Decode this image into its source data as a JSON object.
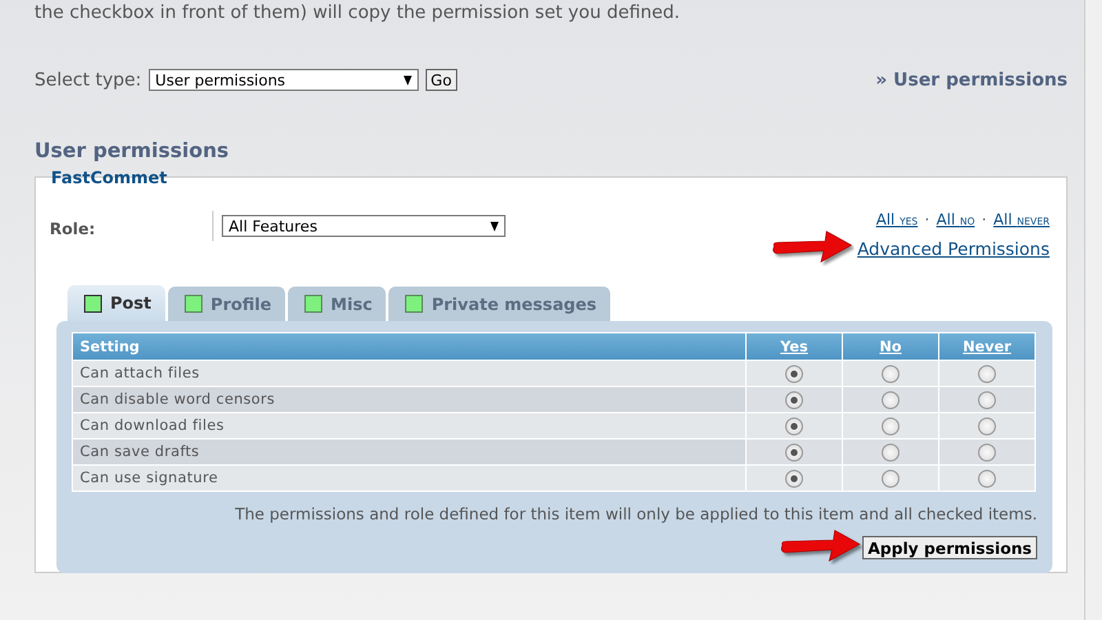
{
  "intro": "the checkbox in front of them) will copy the permission set you defined.",
  "select_type": {
    "label": "Select type:",
    "value": "User permissions",
    "button": "Go"
  },
  "breadcrumb": "» User permissions",
  "heading": "User permissions",
  "group": {
    "legend": "FastCommet",
    "role": {
      "label": "Role:",
      "value": "All Features"
    },
    "all_links": [
      {
        "text": "All",
        "small": "yes"
      },
      {
        "text": "All",
        "small": "no"
      },
      {
        "text": "All",
        "small": "never"
      }
    ],
    "separator": "·",
    "advanced_link": "Advanced Permissions",
    "tabs": [
      {
        "label": "Post",
        "selected": true
      },
      {
        "label": "Profile",
        "selected": false
      },
      {
        "label": "Misc",
        "selected": false
      },
      {
        "label": "Private messages",
        "selected": false
      }
    ],
    "table": {
      "columns": [
        "Setting",
        "Yes",
        "No",
        "Never"
      ],
      "rows": [
        {
          "setting": "Can attach files",
          "options": [
            {
              "selected": true
            },
            {
              "selected": false
            },
            {
              "selected": false
            }
          ]
        },
        {
          "setting": "Can disable word censors",
          "options": [
            {
              "selected": true
            },
            {
              "selected": false
            },
            {
              "selected": false
            }
          ]
        },
        {
          "setting": "Can download files",
          "options": [
            {
              "selected": true
            },
            {
              "selected": false
            },
            {
              "selected": false
            }
          ]
        },
        {
          "setting": "Can save drafts",
          "options": [
            {
              "selected": true
            },
            {
              "selected": false
            },
            {
              "selected": false
            }
          ]
        },
        {
          "setting": "Can use signature",
          "options": [
            {
              "selected": true
            },
            {
              "selected": false
            },
            {
              "selected": false
            }
          ]
        }
      ]
    },
    "note": "The permissions and role defined for this item will only be applied to this item and all checked items.",
    "apply_button": "Apply permissions"
  }
}
